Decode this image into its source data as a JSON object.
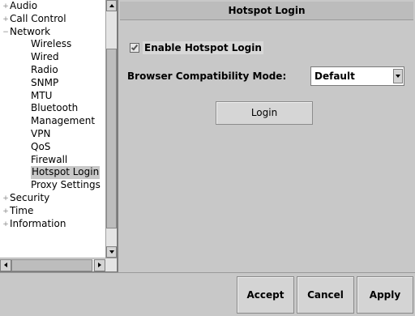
{
  "tree": {
    "items": [
      {
        "label": "Audio",
        "level": 0,
        "expander": "+"
      },
      {
        "label": "Call Control",
        "level": 0,
        "expander": "+"
      },
      {
        "label": "Network",
        "level": 0,
        "expander": "−"
      },
      {
        "label": "Wireless",
        "level": 1
      },
      {
        "label": "Wired",
        "level": 1
      },
      {
        "label": "Radio",
        "level": 1
      },
      {
        "label": "SNMP",
        "level": 1
      },
      {
        "label": "MTU",
        "level": 1
      },
      {
        "label": "Bluetooth",
        "level": 1
      },
      {
        "label": "Management",
        "level": 1
      },
      {
        "label": "VPN",
        "level": 1
      },
      {
        "label": "QoS",
        "level": 1
      },
      {
        "label": "Firewall",
        "level": 1
      },
      {
        "label": "Hotspot Login",
        "level": 1,
        "selected": true
      },
      {
        "label": "Proxy Settings",
        "level": 1
      },
      {
        "label": "Security",
        "level": 0,
        "expander": "+"
      },
      {
        "label": "Time",
        "level": 0,
        "expander": "+"
      },
      {
        "label": "Information",
        "level": 0,
        "expander": "+"
      }
    ]
  },
  "page": {
    "title": "Hotspot Login",
    "enable_label": "Enable Hotspot Login",
    "enable_checked": true,
    "compat_label": "Browser Compatibility Mode:",
    "compat_value": "Default",
    "login_label": "Login"
  },
  "actions": {
    "accept": "Accept",
    "cancel": "Cancel",
    "apply": "Apply"
  },
  "colors": {
    "background": "#c8c8c8",
    "tree_background": "#ffffff",
    "header": "#bcbcbc"
  }
}
